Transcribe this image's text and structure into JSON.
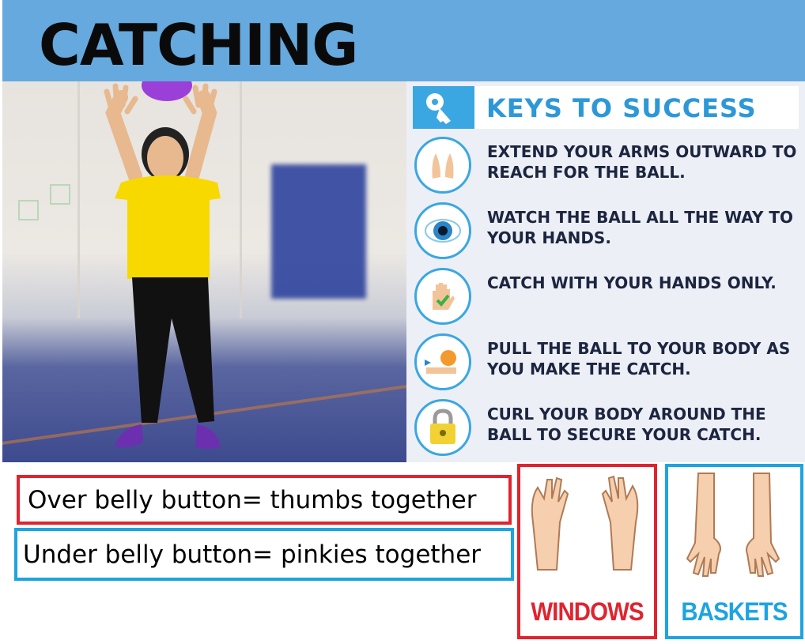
{
  "header": {
    "title": "CATCHING",
    "background": "#65a9de"
  },
  "keys_panel": {
    "title": "KEYS TO SUCCESS",
    "title_icon": "key-icon",
    "accent": "#3aa7e2",
    "items": [
      {
        "text": "EXTEND YOUR ARMS OUTWARD TO REACH FOR THE BALL.",
        "icon": "reaching-hands-icon"
      },
      {
        "text": "WATCH THE BALL ALL THE WAY TO YOUR HANDS.",
        "icon": "eye-icon"
      },
      {
        "text": "CATCH WITH YOUR HANDS ONLY.",
        "icon": "hand-check-icon"
      },
      {
        "text": "PULL THE BALL TO YOUR BODY AS YOU MAKE THE CATCH.",
        "icon": "pull-ball-icon"
      },
      {
        "text": "CURL YOUR BODY AROUND THE BALL TO SECURE YOUR CATCH.",
        "icon": "padlock-icon"
      }
    ]
  },
  "rules": {
    "over": "Over belly button= thumbs together",
    "under": "Under belly button= pinkies together"
  },
  "grips": {
    "windows": {
      "label": "WINDOWS",
      "color": "#e0242f",
      "icon": "raised-hands-icon"
    },
    "baskets": {
      "label": "BASKETS",
      "color": "#1ea4e0",
      "icon": "lowered-hands-icon"
    }
  },
  "colors": {
    "shirt": "#f7d900",
    "ball": "#9b3fd9",
    "shoes": "#6b2fb0",
    "red_border": "#e0242f",
    "blue_border": "#1ea4e0"
  }
}
